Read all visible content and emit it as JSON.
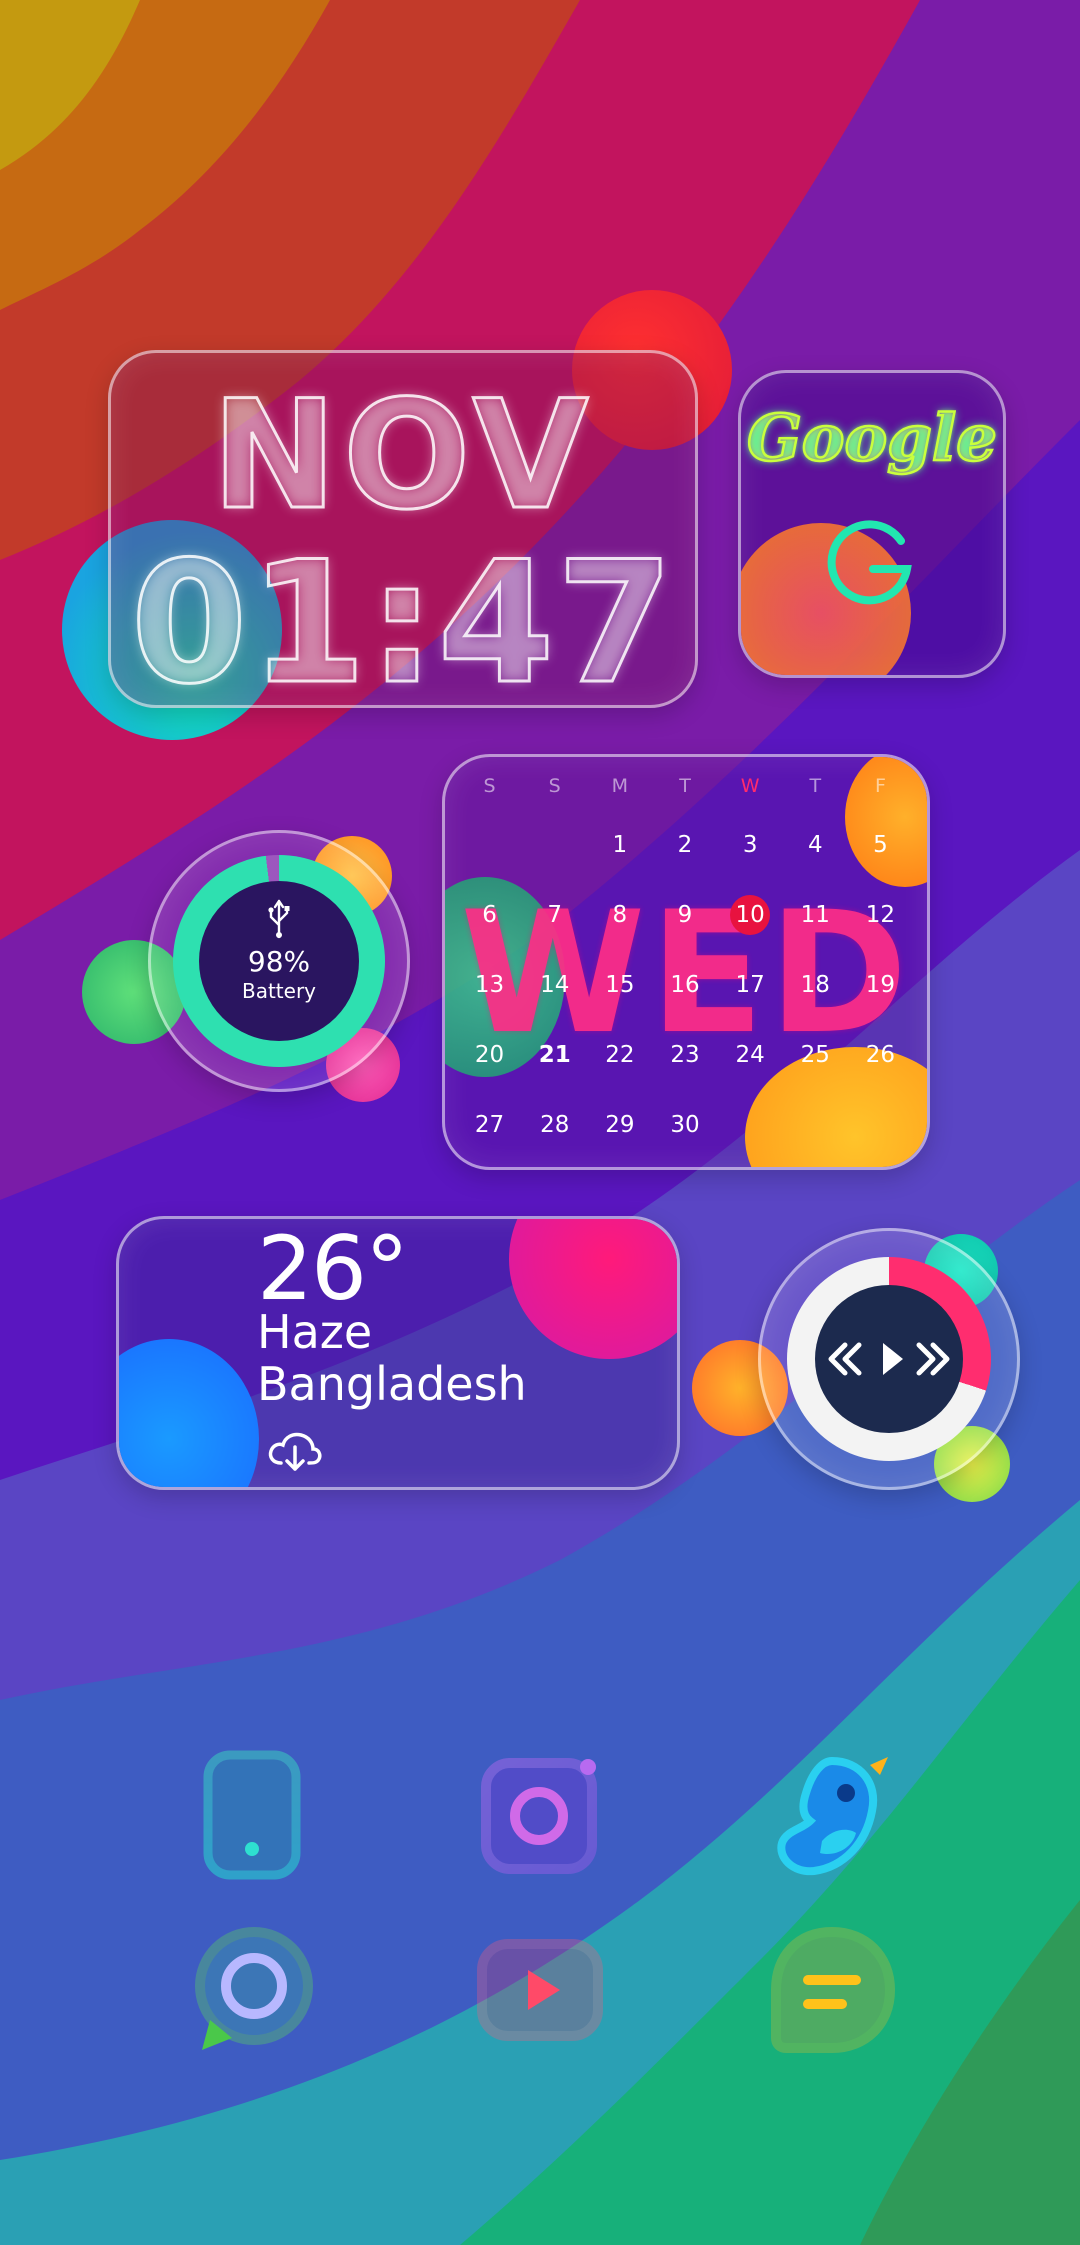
{
  "clock": {
    "month": "NOV",
    "time": "01:47"
  },
  "google": {
    "wordmark": "Google",
    "icon": "google-g-icon"
  },
  "battery": {
    "percent": "98%",
    "label": "Battery",
    "level": 0.98,
    "icon": "usb-icon"
  },
  "calendar": {
    "weekday_banner": "WED",
    "headers": [
      "S",
      "S",
      "M",
      "T",
      "W",
      "T",
      "F"
    ],
    "highlight_header_index": 4,
    "days": [
      "",
      "",
      "1",
      "2",
      "3",
      "4",
      "5",
      "6",
      "7",
      "8",
      "9",
      "10",
      "11",
      "12",
      "13",
      "14",
      "15",
      "16",
      "17",
      "18",
      "19",
      "20",
      "21",
      "22",
      "23",
      "24",
      "25",
      "26",
      "27",
      "28",
      "29",
      "30",
      "",
      "",
      ""
    ],
    "today": "10",
    "bold_day": "21"
  },
  "weather": {
    "temperature": "26°",
    "condition": "Haze",
    "location": "Bangladesh",
    "icon": "cloud-download-icon"
  },
  "music": {
    "icons": [
      "rewind-icon",
      "play-icon",
      "fast-forward-icon"
    ],
    "progress": 0.3
  },
  "apps": [
    {
      "name": "phone-app-icon"
    },
    {
      "name": "instagram-app-icon"
    },
    {
      "name": "twitter-bird-app-icon"
    },
    {
      "name": "messenger-app-icon"
    },
    {
      "name": "youtube-app-icon"
    },
    {
      "name": "chat-app-icon"
    }
  ],
  "colors": {
    "accent_teal": "#2ee0b0",
    "accent_pink": "#ff2d87",
    "today_red": "#e8123f"
  }
}
